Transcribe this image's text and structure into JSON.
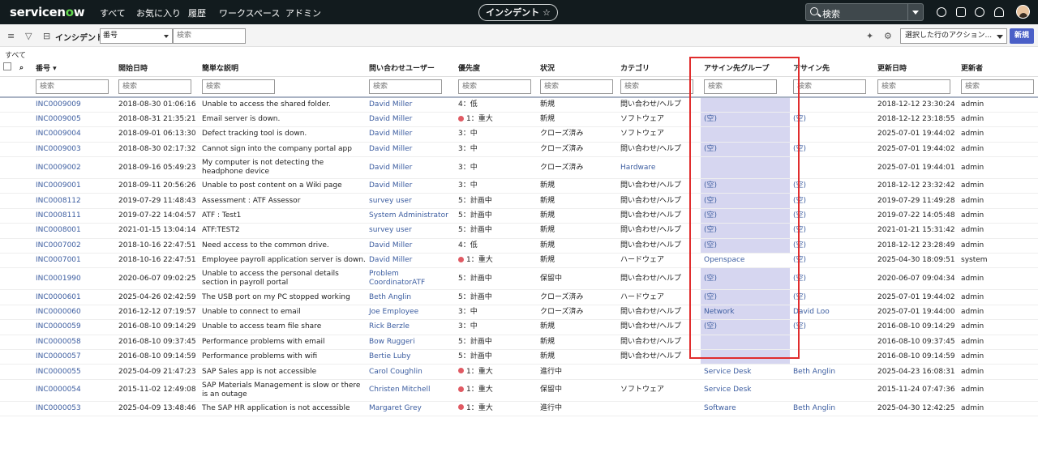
{
  "topnav": {
    "logo_text_a": "servicen",
    "logo_text_o": "o",
    "logo_text_b": "w",
    "items": [
      "すべて",
      "お気に入り",
      "履歴",
      "ワークスペース",
      "アドミン"
    ],
    "context_pill": "インシデント ☆",
    "search_placeholder": "検索"
  },
  "toolbar": {
    "list_title": "インシデント",
    "field_select": "番号",
    "search_placeholder": "検索",
    "action_select": "選択した行のアクション...",
    "new_button": "新規"
  },
  "breadcrumb": "すべて",
  "columns": [
    "番号",
    "開始日時",
    "簡単な説明",
    "問い合わせユーザー",
    "優先度",
    "状況",
    "カテゴリ",
    "アサイン先グループ",
    "アサイン先",
    "更新日時",
    "更新者"
  ],
  "filter_placeholder": "検索",
  "rows": [
    [
      "INC0009009",
      "2018-08-30 01:06:16",
      "Unable to access the shared folder.",
      "David Miller",
      "4：低",
      "新規",
      "問い合わせ/ヘルプ",
      "",
      "",
      "2018-12-12 23:30:24",
      "admin"
    ],
    [
      "INC0009005",
      "2018-08-31 21:35:21",
      "Email server is down.",
      "David Miller",
      "1：重大",
      "新規",
      "ソフトウェア",
      "(空)",
      "(空)",
      "2018-12-12 23:18:55",
      "admin"
    ],
    [
      "INC0009004",
      "2018-09-01 06:13:30",
      "Defect tracking tool is down.",
      "David Miller",
      "3：中",
      "クローズ済み",
      "ソフトウェア",
      "",
      "",
      "2025-07-01 19:44:02",
      "admin"
    ],
    [
      "INC0009003",
      "2018-08-30 02:17:32",
      "Cannot sign into the company portal app",
      "David Miller",
      "3：中",
      "クローズ済み",
      "問い合わせ/ヘルプ",
      "(空)",
      "(空)",
      "2025-07-01 19:44:02",
      "admin"
    ],
    [
      "INC0009002",
      "2018-09-16 05:49:23",
      "My computer is not detecting the headphone device",
      "David Miller",
      "3：中",
      "クローズ済み",
      "Hardware",
      "",
      "",
      "2025-07-01 19:44:01",
      "admin"
    ],
    [
      "INC0009001",
      "2018-09-11 20:56:26",
      "Unable to post content on a Wiki page",
      "David Miller",
      "3：中",
      "新規",
      "問い合わせ/ヘルプ",
      "(空)",
      "(空)",
      "2018-12-12 23:32:42",
      "admin"
    ],
    [
      "INC0008112",
      "2019-07-29 11:48:43",
      "Assessment : ATF Assessor",
      "survey user",
      "5：計画中",
      "新規",
      "問い合わせ/ヘルプ",
      "(空)",
      "(空)",
      "2019-07-29 11:49:28",
      "admin"
    ],
    [
      "INC0008111",
      "2019-07-22 14:04:57",
      "ATF : Test1",
      "System Administrator",
      "5：計画中",
      "新規",
      "問い合わせ/ヘルプ",
      "(空)",
      "(空)",
      "2019-07-22 14:05:48",
      "admin"
    ],
    [
      "INC0008001",
      "2021-01-15 13:04:14",
      "ATF:TEST2",
      "survey user",
      "5：計画中",
      "新規",
      "問い合わせ/ヘルプ",
      "(空)",
      "(空)",
      "2021-01-21 15:31:42",
      "admin"
    ],
    [
      "INC0007002",
      "2018-10-16 22:47:51",
      "Need access to the common drive.",
      "David Miller",
      "4：低",
      "新規",
      "問い合わせ/ヘルプ",
      "(空)",
      "(空)",
      "2018-12-12 23:28:49",
      "admin"
    ],
    [
      "INC0007001",
      "2018-10-16 22:47:51",
      "Employee payroll application server is down.",
      "David Miller",
      "1：重大",
      "新規",
      "ハードウェア",
      "Openspace",
      "(空)",
      "2025-04-30 18:09:51",
      "system"
    ],
    [
      "INC0001990",
      "2020-06-07 09:02:25",
      "Unable to access the personal details section in payroll portal",
      "Problem CoordinatorATF",
      "5：計画中",
      "保留中",
      "問い合わせ/ヘルプ",
      "(空)",
      "(空)",
      "2020-06-07 09:04:34",
      "admin"
    ],
    [
      "INC0000601",
      "2025-04-26 02:42:59",
      "The USB port on my PC stopped working",
      "Beth Anglin",
      "5：計画中",
      "クローズ済み",
      "ハードウェア",
      "(空)",
      "(空)",
      "2025-07-01 19:44:02",
      "admin"
    ],
    [
      "INC0000060",
      "2016-12-12 07:19:57",
      "Unable to connect to email",
      "Joe Employee",
      "3：中",
      "クローズ済み",
      "問い合わせ/ヘルプ",
      "Network",
      "David Loo",
      "2025-07-01 19:44:00",
      "admin"
    ],
    [
      "INC0000059",
      "2016-08-10 09:14:29",
      "Unable to access team file share",
      "Rick Berzle",
      "3：中",
      "新規",
      "問い合わせ/ヘルプ",
      "(空)",
      "(空)",
      "2016-08-10 09:14:29",
      "admin"
    ],
    [
      "INC0000058",
      "2016-08-10 09:37:45",
      "Performance problems with email",
      "Bow Ruggeri",
      "5：計画中",
      "新規",
      "問い合わせ/ヘルプ",
      "",
      "",
      "2016-08-10 09:37:45",
      "admin"
    ],
    [
      "INC0000057",
      "2016-08-10 09:14:59",
      "Performance problems with wifi",
      "Bertie Luby",
      "5：計画中",
      "新規",
      "問い合わせ/ヘルプ",
      "",
      "",
      "2016-08-10 09:14:59",
      "admin"
    ],
    [
      "INC0000055",
      "2025-04-09 21:47:23",
      "SAP Sales app is not accessible",
      "Carol Coughlin",
      "1：重大",
      "進行中",
      "",
      "Service Desk",
      "Beth Anglin",
      "2025-04-23 16:08:31",
      "admin"
    ],
    [
      "INC0000054",
      "2015-11-02 12:49:08",
      "SAP Materials Management is slow or there is an outage",
      "Christen Mitchell",
      "1：重大",
      "保留中",
      "ソフトウェア",
      "Service Desk",
      "",
      "2015-11-24 07:47:36",
      "admin"
    ],
    [
      "INC0000053",
      "2025-04-09 13:48:46",
      "The SAP HR application is not accessible",
      "Margaret Grey",
      "1：重大",
      "進行中",
      "",
      "Software",
      "Beth Anglin",
      "2025-04-30 12:42:25",
      "admin"
    ]
  ],
  "colors": {
    "nav_bg": "#121b1e",
    "link": "#3c5da0",
    "group_highlight": "#d6d6f0",
    "annotation_box": "#e02d2d",
    "critical_dot": "#e05a63",
    "new_button": "#4a5fc7"
  }
}
